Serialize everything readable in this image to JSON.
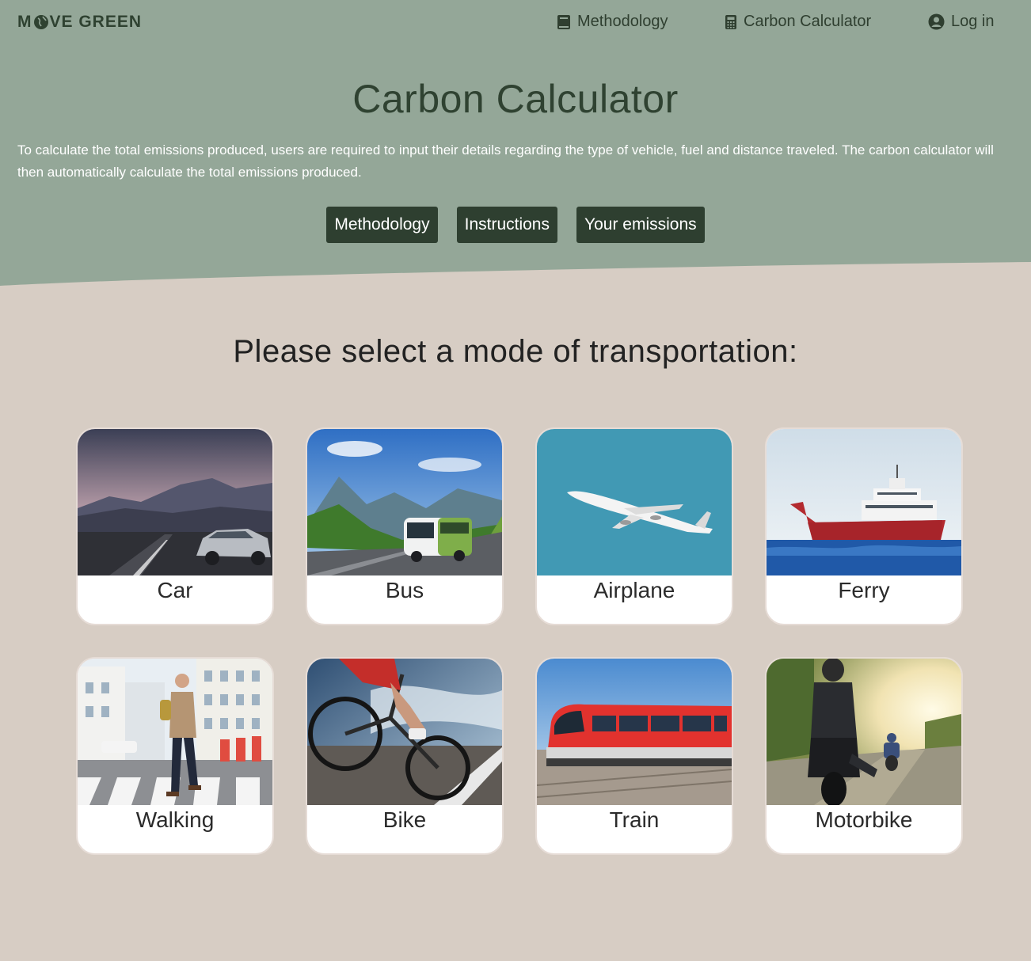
{
  "brand": {
    "logo_left": "M",
    "logo_right": "VE GREEN"
  },
  "nav": {
    "methodology": "Methodology",
    "calculator": "Carbon Calculator",
    "login": "Log in"
  },
  "hero": {
    "title": "Carbon Calculator",
    "intro": "To calculate the total emissions produced, users are required to input their details regarding the type of vehicle, fuel and distance traveled. The carbon calculator will then automatically calculate the total emissions produced.",
    "buttons": [
      "Methodology",
      "Instructions",
      "Your emissions"
    ]
  },
  "section_title": "Please select a mode of transportation:",
  "modes": [
    {
      "label": "Car"
    },
    {
      "label": "Bus"
    },
    {
      "label": "Airplane"
    },
    {
      "label": "Ferry"
    },
    {
      "label": "Walking"
    },
    {
      "label": "Bike"
    },
    {
      "label": "Train"
    },
    {
      "label": "Motorbike"
    }
  ],
  "colors": {
    "header_bg": "#94a798",
    "page_bg": "#d7cdc4",
    "button_bg": "#2e3f30",
    "brand_dark": "#2f4231"
  },
  "icons": {
    "nav_methodology": "book-icon",
    "nav_calculator": "calculator-icon",
    "nav_login": "user-circle-icon",
    "logo_o": "globe-icon"
  }
}
